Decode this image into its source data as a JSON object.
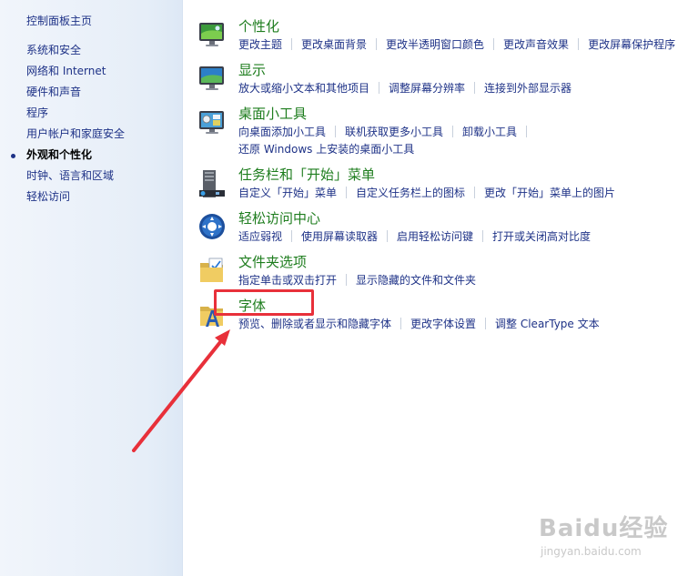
{
  "sidebar": {
    "home": "控制面板主页",
    "items": [
      {
        "label": "系统和安全"
      },
      {
        "label": "网络和 Internet"
      },
      {
        "label": "硬件和声音"
      },
      {
        "label": "程序"
      },
      {
        "label": "用户帐户和家庭安全"
      },
      {
        "label": "外观和个性化"
      },
      {
        "label": "时钟、语言和区域"
      },
      {
        "label": "轻松访问"
      }
    ]
  },
  "categories": [
    {
      "title": "个性化",
      "icon": "personalization-icon",
      "links": [
        [
          "更改主题",
          "更改桌面背景",
          "更改半透明窗口颜色",
          "更改声音效果",
          "更改屏幕保护程序"
        ]
      ]
    },
    {
      "title": "显示",
      "icon": "display-icon",
      "links": [
        [
          "放大或缩小文本和其他项目",
          "调整屏幕分辨率",
          "连接到外部显示器"
        ]
      ]
    },
    {
      "title": "桌面小工具",
      "icon": "gadgets-icon",
      "links": [
        [
          "向桌面添加小工具",
          "联机获取更多小工具",
          "卸载小工具"
        ],
        [
          "还原 Windows 上安装的桌面小工具"
        ]
      ]
    },
    {
      "title": "任务栏和「开始」菜单",
      "icon": "taskbar-icon",
      "links": [
        [
          "自定义「开始」菜单",
          "自定义任务栏上的图标",
          "更改「开始」菜单上的图片"
        ]
      ]
    },
    {
      "title": "轻松访问中心",
      "icon": "ease-of-access-icon",
      "links": [
        [
          "适应弱视",
          "使用屏幕读取器",
          "启用轻松访问键",
          "打开或关闭高对比度"
        ]
      ]
    },
    {
      "title": "文件夹选项",
      "icon": "folder-options-icon",
      "links": [
        [
          "指定单击或双击打开",
          "显示隐藏的文件和文件夹"
        ]
      ]
    },
    {
      "title": "字体",
      "icon": "fonts-icon",
      "links": [
        [
          "预览、删除或者显示和隐藏字体",
          "更改字体设置",
          "调整 ClearType 文本"
        ]
      ]
    }
  ],
  "watermark": {
    "brand": "Baidu经验",
    "url": "jingyan.baidu.com"
  },
  "colors": {
    "link": "#1e3287",
    "category_title": "#1e7d1e",
    "annotation": "#e8303a"
  }
}
